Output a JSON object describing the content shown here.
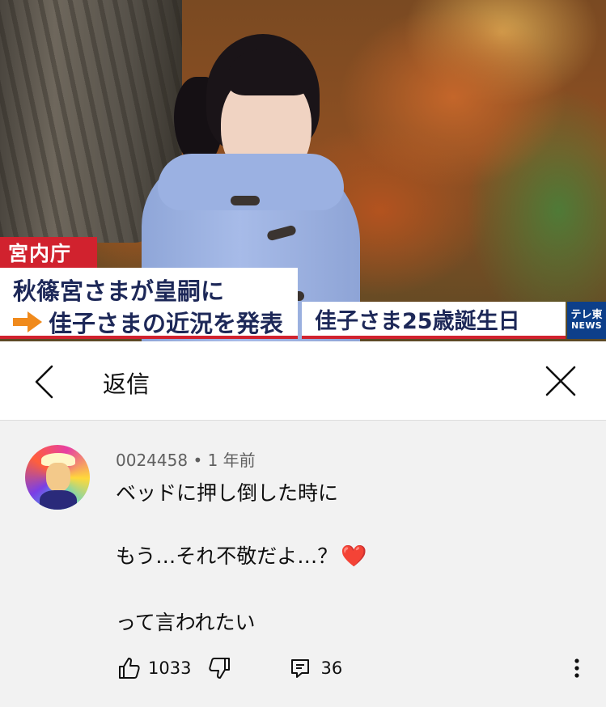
{
  "video": {
    "agency_label": "宮内庁",
    "headline_line1": "秋篠宮さまが皇嗣に",
    "headline_line2": "佳子さまの近況を発表",
    "topic": "佳子さま25歳誕生日",
    "logo_line1": "テレ東",
    "logo_line2": "NEWS",
    "overlay_colors": {
      "red": "#d1222e",
      "navy_text": "#1d2858",
      "arrow_orange": "#f08a1c",
      "logo_blue": "#0d3f8a"
    }
  },
  "header": {
    "back_icon": "chevron-left-icon",
    "title": "返信",
    "close_icon": "close-icon"
  },
  "comment": {
    "author": "0024458",
    "separator": "•",
    "time": "1 年前",
    "lines": [
      "ベッドに押し倒した時に",
      "もう…それ不敬だよ…？",
      "って言われたい"
    ],
    "emoji": "❤️",
    "likes": "1033",
    "replies": "36",
    "icons": [
      "thumbs-up-icon",
      "thumbs-down-icon",
      "reply-icon",
      "more-vert-icon"
    ]
  },
  "colors": {
    "comment_bg": "#f2f2f2",
    "meta_text": "#606060",
    "text": "#0f0f0f"
  }
}
